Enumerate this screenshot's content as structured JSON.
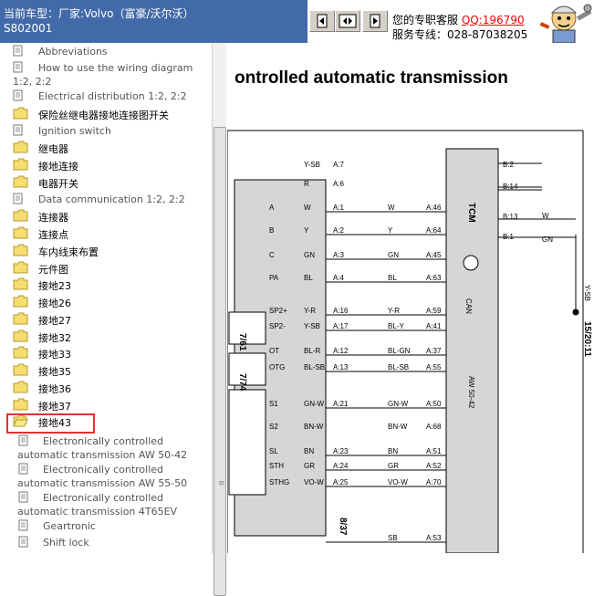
{
  "header": {
    "car_line1": "当前车型：厂家:Volvo（富豪/沃尔沃）",
    "car_line2": "S802001",
    "nav_buttons": [
      "prev",
      "split",
      "next"
    ],
    "service_line1_text": "您的专职客服",
    "service_qq": "QQ:196790",
    "service_line2": "服务专线：028-87038205"
  },
  "tree": {
    "items": [
      {
        "label": "Abbreviations",
        "icon": "doc-icon",
        "style": "gray"
      },
      {
        "label": "How to use the wiring diagram",
        "label2": "1:2, 2:2",
        "icon": "doc-icon",
        "style": "gray"
      },
      {
        "label": "Electrical distribution 1:2, 2:2",
        "icon": "doc-icon",
        "style": "gray"
      },
      {
        "label": "保险丝继电器接地连接图开关",
        "icon": "folder-icon",
        "style": "normal"
      },
      {
        "label": "Ignition switch",
        "icon": "doc-icon",
        "style": "gray"
      },
      {
        "label": "继电器",
        "icon": "folder-icon",
        "style": "normal"
      },
      {
        "label": "接地连接",
        "icon": "folder-icon",
        "style": "normal"
      },
      {
        "label": "电器开关",
        "icon": "folder-icon",
        "style": "normal"
      },
      {
        "label": "Data communication 1:2, 2:2",
        "icon": "doc-icon",
        "style": "gray"
      },
      {
        "label": "连接器",
        "icon": "folder-icon",
        "style": "normal"
      },
      {
        "label": "连接点",
        "icon": "folder-icon",
        "style": "normal"
      },
      {
        "label": "车内线束布置",
        "icon": "folder-icon",
        "style": "normal"
      },
      {
        "label": "元件图",
        "icon": "folder-icon",
        "style": "normal"
      },
      {
        "label": "接地23",
        "icon": "folder-icon",
        "style": "normal"
      },
      {
        "label": "接地26",
        "icon": "folder-icon",
        "style": "normal"
      },
      {
        "label": "接地27",
        "icon": "folder-icon",
        "style": "normal"
      },
      {
        "label": "接地32",
        "icon": "folder-icon",
        "style": "normal"
      },
      {
        "label": "接地33",
        "icon": "folder-icon",
        "style": "normal"
      },
      {
        "label": "接地35",
        "icon": "folder-icon",
        "style": "normal"
      },
      {
        "label": "接地36",
        "icon": "folder-icon",
        "style": "normal"
      },
      {
        "label": "接地37",
        "icon": "folder-icon",
        "style": "normal"
      },
      {
        "label": "接地43",
        "icon": "open-folder-icon",
        "style": "selected"
      }
    ],
    "sub_items": [
      {
        "label": "Electronically controlled",
        "label2": "automatic transmission AW 50-42"
      },
      {
        "label": "Electronically controlled",
        "label2": "automatic transmission AW 55-50"
      },
      {
        "label": "Electronically controlled",
        "label2": "automatic transmission 4T65EV"
      },
      {
        "label": "Geartronic",
        "label2": ""
      },
      {
        "label": "Shift lock",
        "label2": ""
      }
    ]
  },
  "diagram": {
    "title": "ontrolled automatic transmission",
    "left_block_labels": [
      "Y-SB",
      "R",
      "W",
      "Y",
      "GN",
      "BL",
      "Y-R",
      "Y-SB",
      "BL-R",
      "BL-SB",
      "GN-W",
      "BN-W",
      "BN",
      "GR",
      "VO-W"
    ],
    "left_pins": [
      "A:7",
      "A:6",
      "A:1",
      "A:2",
      "A:3",
      "A:4",
      "A:16",
      "A:17",
      "A:12",
      "A:13",
      "A:21",
      "A:23",
      "A:24",
      "A:25"
    ],
    "inner_labels": [
      "A",
      "B",
      "C",
      "PA",
      "SP2+",
      "SP2-",
      "OT",
      "OTG",
      "S1",
      "S2",
      "SL",
      "STH",
      "STHG"
    ],
    "wire_colors": [
      "W",
      "Y",
      "GN",
      "BL",
      "Y-R",
      "BL-Y",
      "BL-GN",
      "BL-SB",
      "GN-W",
      "BN-W",
      "BN",
      "GR",
      "VO-W",
      "SB"
    ],
    "right_pins": [
      "A:46",
      "A:64",
      "A:45",
      "A:63",
      "A:59",
      "A:41",
      "A:37",
      "A:55",
      "A:50",
      "A:68",
      "A:51",
      "A:52",
      "A:70",
      "A:53"
    ],
    "tcm_label": "TCM",
    "tcm_model": "AW 50-42",
    "tcm_can": "CAN",
    "tcm_pins_b": [
      "B:2",
      "B:14",
      "B:13",
      "B:1"
    ],
    "right_wires": [
      "W",
      "GN",
      "Y-SB"
    ],
    "ref_761": "7/61",
    "ref_774": "7/74",
    "ref_837": "8/37",
    "ref_1520": "15/20:11"
  }
}
